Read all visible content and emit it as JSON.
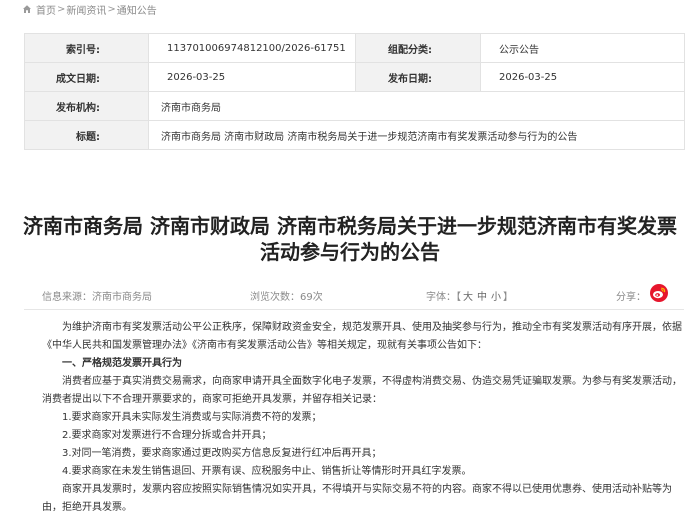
{
  "breadcrumb": {
    "items": [
      "首页",
      "新闻资讯",
      "通知公告"
    ],
    "separator": ">"
  },
  "meta": {
    "rows": [
      {
        "label1": "索引号:",
        "value1": "113701006974812100/2026-61751",
        "label2": "组配分类:",
        "value2": "公示公告"
      },
      {
        "label1": "成文日期:",
        "value1": "2026-03-25",
        "label2": "发布日期:",
        "value2": "2026-03-25"
      }
    ],
    "issuer_label": "发布机构:",
    "issuer_value": "济南市商务局",
    "subject_label": "标题:",
    "subject_value": "济南市商务局 济南市财政局 济南市税务局关于进一步规范济南市有奖发票活动参与行为的公告"
  },
  "article": {
    "title_line1": "济南市商务局 济南市财政局 济南市税务局关于进一步规范济南市有奖发票",
    "title_line2": "活动参与行为的公告"
  },
  "info": {
    "source": "信息来源：济南市商务局",
    "views": "浏览次数：69次",
    "font_label": "字体：",
    "font_open": "【",
    "font_large": "大",
    "font_medium": "中",
    "font_small": "小",
    "font_close": "】",
    "share_label": "分享："
  },
  "body": {
    "intro": "为维护济南市有奖发票活动公平公正秩序，保障财政资金安全，规范发票开具、使用及抽奖参与行为，推动全市有奖发票活动有序开展，依据《中华人民共和国发票管理办法》《济南市有奖发票活动公告》等相关规定，现就有关事项公告如下：",
    "section1_heading": "一、严格规范发票开具行为",
    "section1_para": "消费者应基于真实消费交易需求，向商家申请开具全面数字化电子发票，不得虚构消费交易、伪造交易凭证骗取发票。为参与有奖发票活动，消费者提出以下不合理开票要求的，商家可拒绝开具发票，并留存相关记录：",
    "item1": "1.要求商家开具未实际发生消费或与实际消费不符的发票；",
    "item2": "2.要求商家对发票进行不合理分拆或合并开具；",
    "item3": "3.对同一笔消费，要求商家通过更改购买方信息反复进行红冲后再开具；",
    "item4": "4.要求商家在未发生销售退回、开票有误、应税服务中止、销售折让等情形时开具红字发票。",
    "closing": "商家开具发票时，发票内容应按照实际销售情况如实开具，不得填开与实际交易不符的内容。商家不得以已使用优惠券、使用活动补贴等为由，拒绝开具发票。"
  },
  "colors": {
    "label_bg": "#f2f2f2",
    "border": "#e2e2e2",
    "weibo_red": "#e6162d",
    "muted_text": "#8a8a8a"
  }
}
